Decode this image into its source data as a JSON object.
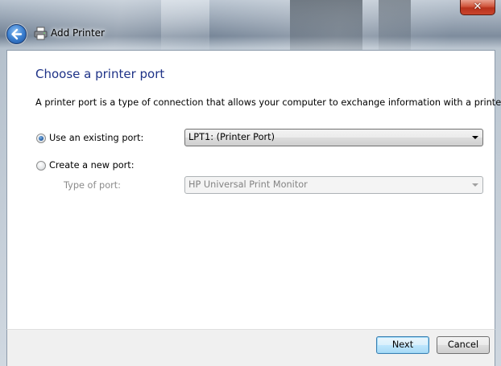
{
  "window": {
    "title": "Add Printer",
    "close_glyph": "✕"
  },
  "page": {
    "heading": "Choose a printer port",
    "description": "A printer port is a type of connection that allows your computer to exchange information with a printer."
  },
  "options": {
    "existing": {
      "label": "Use an existing port:",
      "selected": true,
      "dropdown_value": "LPT1: (Printer Port)"
    },
    "new": {
      "label": "Create a new port:",
      "selected": false,
      "type_label": "Type of port:",
      "type_value": "HP Universal Print Monitor",
      "disabled": true
    }
  },
  "footer": {
    "next_label": "Next",
    "cancel_label": "Cancel"
  },
  "colors": {
    "heading": "#1e3287",
    "accent": "#3c7fb1"
  },
  "icons": {
    "back": "back-arrow-icon",
    "printer": "printer-icon",
    "close": "close-icon",
    "dropdown": "chevron-down-icon"
  }
}
